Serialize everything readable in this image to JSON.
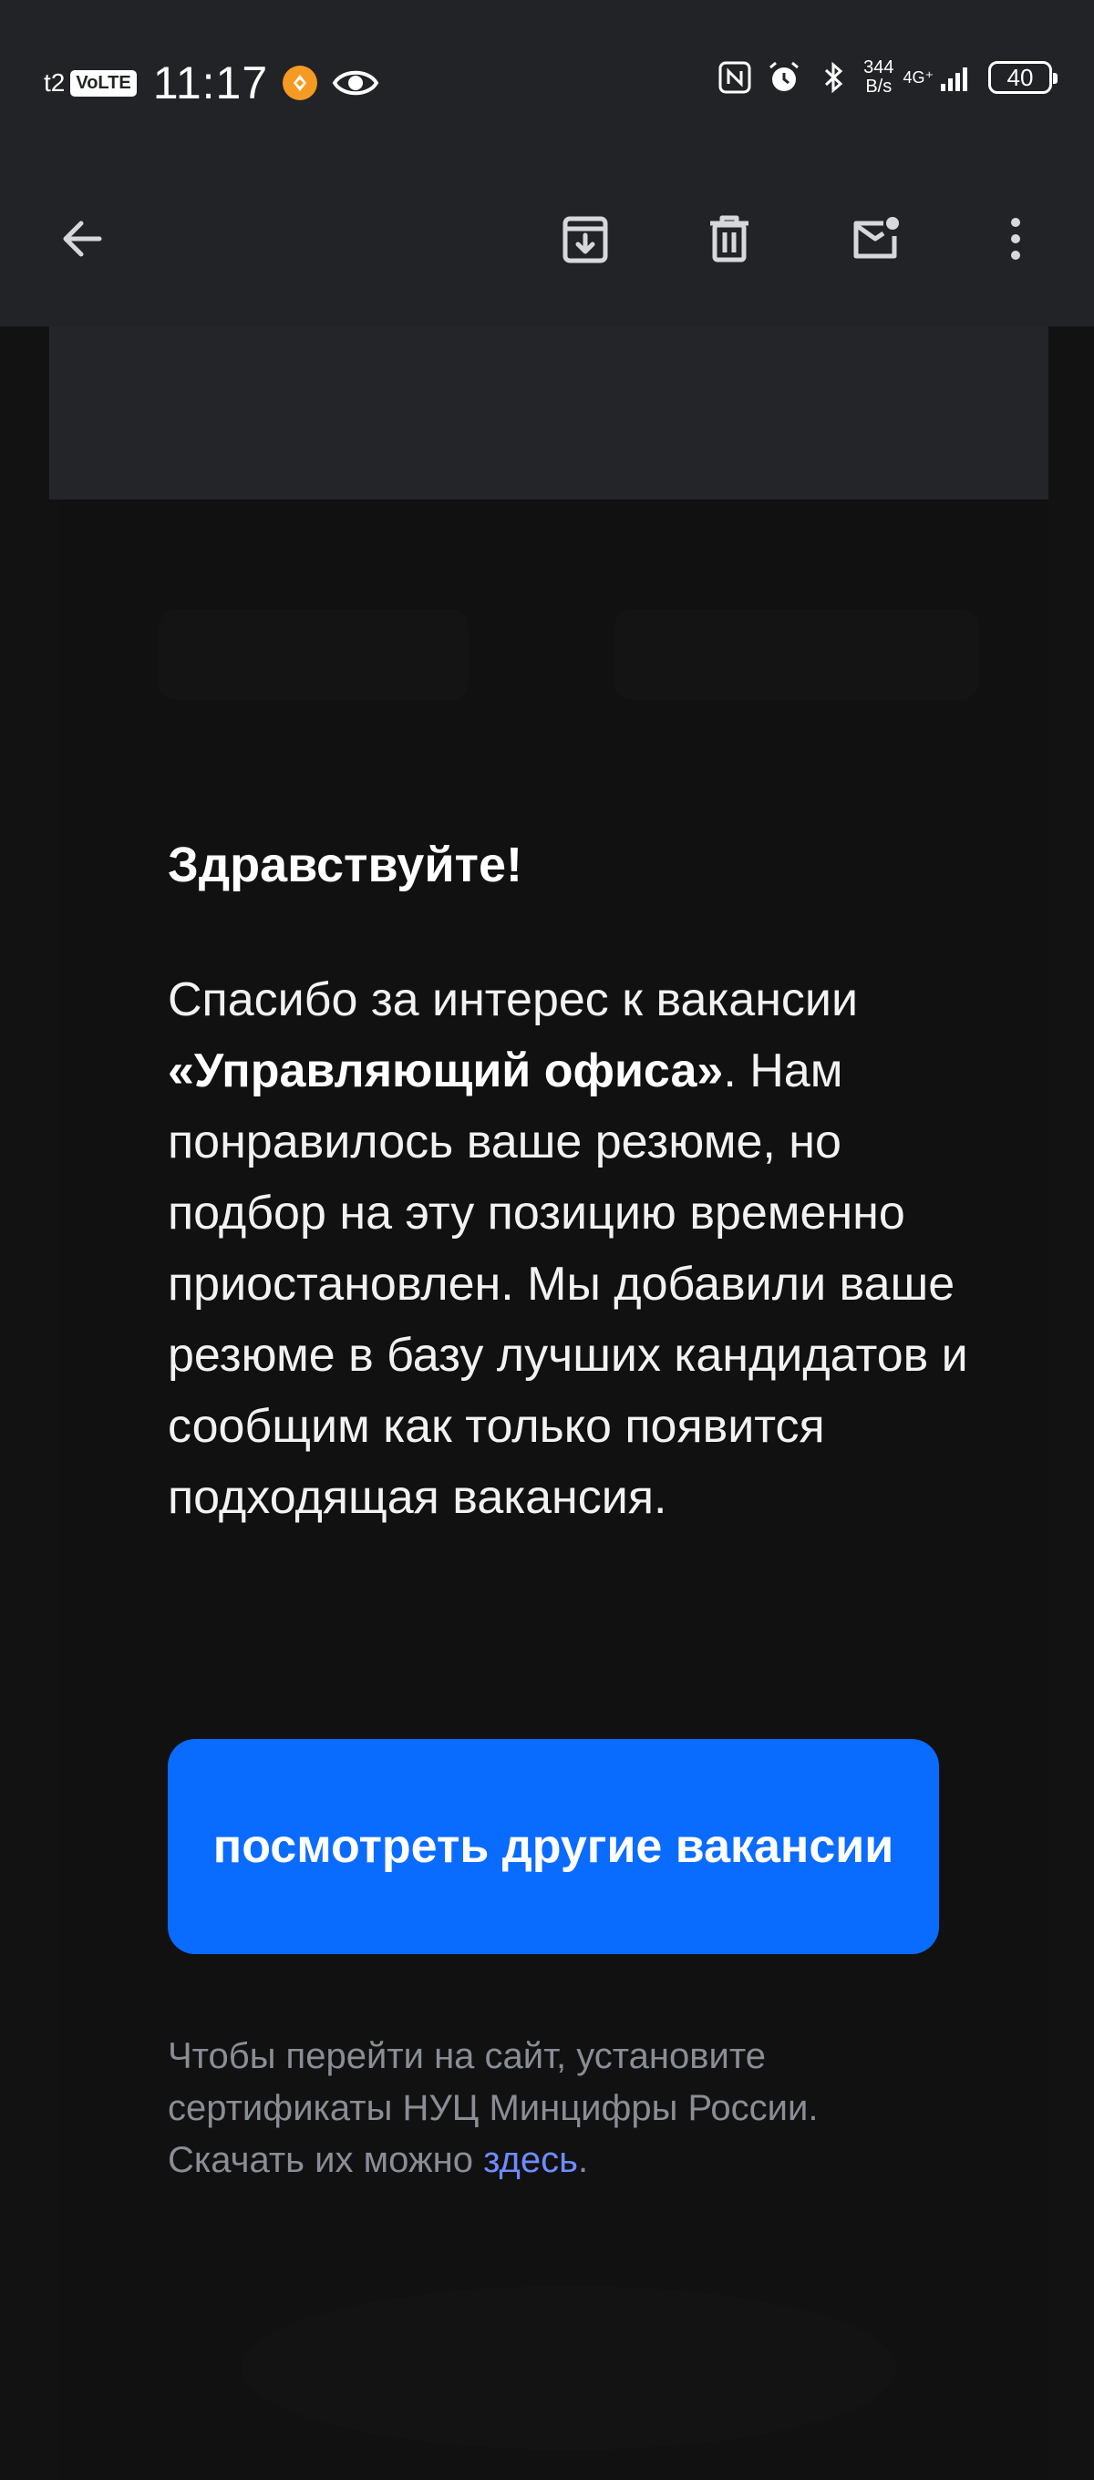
{
  "status_bar": {
    "carrier": "t2",
    "volte": "VoLTE",
    "time": "11:17",
    "speed_value": "344",
    "speed_unit": "B/s",
    "network": "4G⁺",
    "battery": "40"
  },
  "toolbar": {
    "back": "arrow-left-icon",
    "archive": "archive-icon",
    "delete": "trash-icon",
    "mark_unread": "mail-unread-icon",
    "more": "more-vertical-icon"
  },
  "email": {
    "greeting": "Здравствуйте!",
    "body_before": "Спасибо за интерес к вакансии ",
    "vacancy": "«Управляющий офиса»",
    "body_after": ". Нам понравилось ваше резюме, но подбор на эту позицию временно приостановлен. Мы добавили ваше резюме в базу лучших кандидатов и сообщим как только появится подходящая вакансия.",
    "cta_label": "посмотреть другие вакансии",
    "footnote_text": "Чтобы перейти на сайт, установите сертификаты НУЦ Минцифры России. Скачать их можно ",
    "footnote_link": "здесь",
    "footnote_end": "."
  },
  "colors": {
    "background": "#121212",
    "toolbar": "#222326",
    "cta": "#0a6bff",
    "link": "#6f8cff",
    "muted_text": "#8a8d94"
  }
}
